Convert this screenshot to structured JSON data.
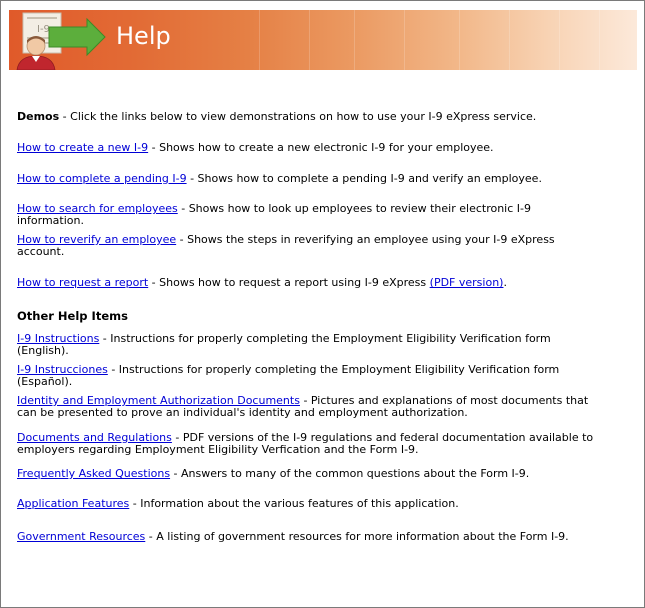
{
  "banner": {
    "title": "Help",
    "logo_icon": "i9-document-arrow-person-icon",
    "logo_text": "I-9"
  },
  "demos": {
    "heading": "Demos",
    "intro": " - Click the links below to view demonstrations on how to use your I-9 eXpress service.",
    "items": [
      {
        "link": "How to create a new I-9",
        "desc": " - Shows how to create a new electronic I-9 for your employee."
      },
      {
        "link": "How to complete a pending I-9",
        "desc": " - Shows how to complete a pending I-9 and verify an employee."
      },
      {
        "link": "How to search for employees",
        "desc": " - Shows how to look up employees to review their electronic I-9",
        "desc2": "information."
      },
      {
        "link": "How to reverify an employee",
        "desc": " - Shows the steps in reverifying an employee using your I-9 eXpress",
        "desc2": "account."
      },
      {
        "link": "How to request a report",
        "desc": " - Shows how to request a report using I-9 eXpress ",
        "link2": "(PDF version)",
        "tail": "."
      }
    ]
  },
  "other": {
    "heading": "Other Help Items",
    "items": [
      {
        "link": "I-9 Instructions",
        "desc": " - Instructions for properly completing the Employment Eligibility Verification form",
        "desc2": "(English)."
      },
      {
        "link": "I-9 Instrucciones",
        "desc": " - Instructions for properly completing the Employment Eligibility Verification form",
        "desc2": "(Español)."
      },
      {
        "link": "Identity and Employment Authorization Documents",
        "desc": " - Pictures and explanations of most documents that",
        "desc2": "can be presented to prove an individual's identity and employment authorization."
      },
      {
        "link": "Documents and Regulations",
        "desc": " - PDF versions of the I-9 regulations and federal documentation available to",
        "desc2": "employers regarding Employment Eligibility Verfication and the Form I-9."
      },
      {
        "link": "Frequently Asked Questions",
        "desc": " - Answers to many of the common questions about the Form I-9."
      },
      {
        "link": "Application Features",
        "desc": " - Information about the various features of this application."
      },
      {
        "link": "Government Resources",
        "desc": " - A listing of government resources for more information about the Form I-9."
      }
    ]
  }
}
